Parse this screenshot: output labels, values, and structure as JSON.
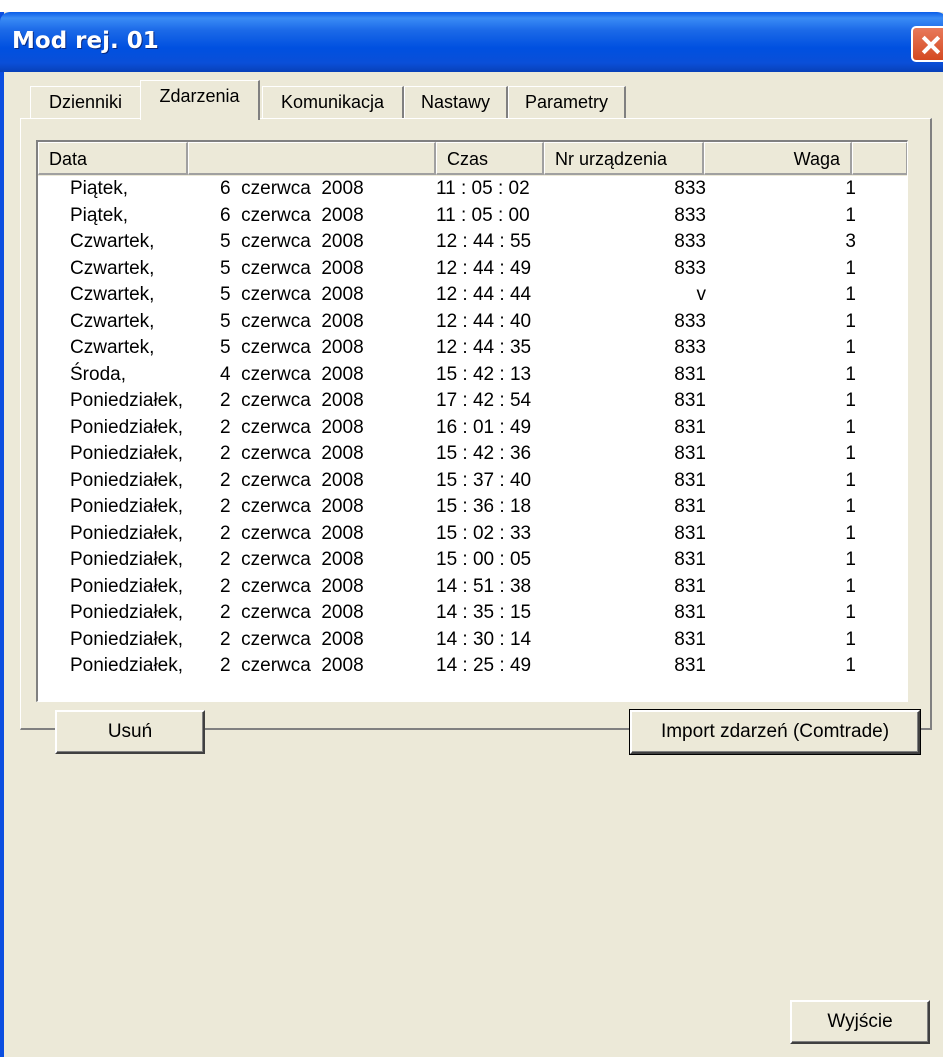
{
  "window": {
    "title": "Mod rej. 01"
  },
  "tabs": [
    {
      "label": "Dzienniki"
    },
    {
      "label": "Zdarzenia"
    },
    {
      "label": "Komunikacja"
    },
    {
      "label": "Nastawy"
    },
    {
      "label": "Parametry"
    }
  ],
  "active_tab": "Zdarzenia",
  "table": {
    "columns": [
      "Data",
      "",
      "Czas",
      "Nr urządzenia",
      "Waga"
    ],
    "rows": [
      [
        "Piątek,",
        "6  czerwca  2008",
        "11 : 05 : 02",
        "833",
        "1"
      ],
      [
        "Piątek,",
        "6  czerwca  2008",
        "11 : 05 : 00",
        "833",
        "1"
      ],
      [
        "Czwartek,",
        "5  czerwca  2008",
        "12 : 44 : 55",
        "833",
        "3"
      ],
      [
        "Czwartek,",
        "5  czerwca  2008",
        "12 : 44 : 49",
        "833",
        "1"
      ],
      [
        "Czwartek,",
        "5  czerwca  2008",
        "12 : 44 : 44",
        "v",
        "1"
      ],
      [
        "Czwartek,",
        "5  czerwca  2008",
        "12 : 44 : 40",
        "833",
        "1"
      ],
      [
        "Czwartek,",
        "5  czerwca  2008",
        "12 : 44 : 35",
        "833",
        "1"
      ],
      [
        "Środa,",
        "4  czerwca  2008",
        "15 : 42 : 13",
        "831",
        "1"
      ],
      [
        "Poniedziałek,",
        "2  czerwca  2008",
        "17 : 42 : 54",
        "831",
        "1"
      ],
      [
        "Poniedziałek,",
        "2  czerwca  2008",
        "16 : 01 : 49",
        "831",
        "1"
      ],
      [
        "Poniedziałek,",
        "2  czerwca  2008",
        "15 : 42 : 36",
        "831",
        "1"
      ],
      [
        "Poniedziałek,",
        "2  czerwca  2008",
        "15 : 37 : 40",
        "831",
        "1"
      ],
      [
        "Poniedziałek,",
        "2  czerwca  2008",
        "15 : 36 : 18",
        "831",
        "1"
      ],
      [
        "Poniedziałek,",
        "2  czerwca  2008",
        "15 : 02 : 33",
        "831",
        "1"
      ],
      [
        "Poniedziałek,",
        "2  czerwca  2008",
        "15 : 00 : 05",
        "831",
        "1"
      ],
      [
        "Poniedziałek,",
        "2  czerwca  2008",
        "14 : 51 : 38",
        "831",
        "1"
      ],
      [
        "Poniedziałek,",
        "2  czerwca  2008",
        "14 : 35 : 15",
        "831",
        "1"
      ],
      [
        "Poniedziałek,",
        "2  czerwca  2008",
        "14 : 30 : 14",
        "831",
        "1"
      ],
      [
        "Poniedziałek,",
        "2  czerwca  2008",
        "14 : 25 : 49",
        "831",
        "1"
      ]
    ]
  },
  "buttons": {
    "delete": "Usuń",
    "import": "Import zdarzeń (Comtrade)",
    "exit": "Wyjście"
  },
  "colors": {
    "titlebar": "#0a4fd8",
    "window_bg": "#ece9d8",
    "close": "#d44a22"
  },
  "icons": {
    "close": "close-icon"
  }
}
